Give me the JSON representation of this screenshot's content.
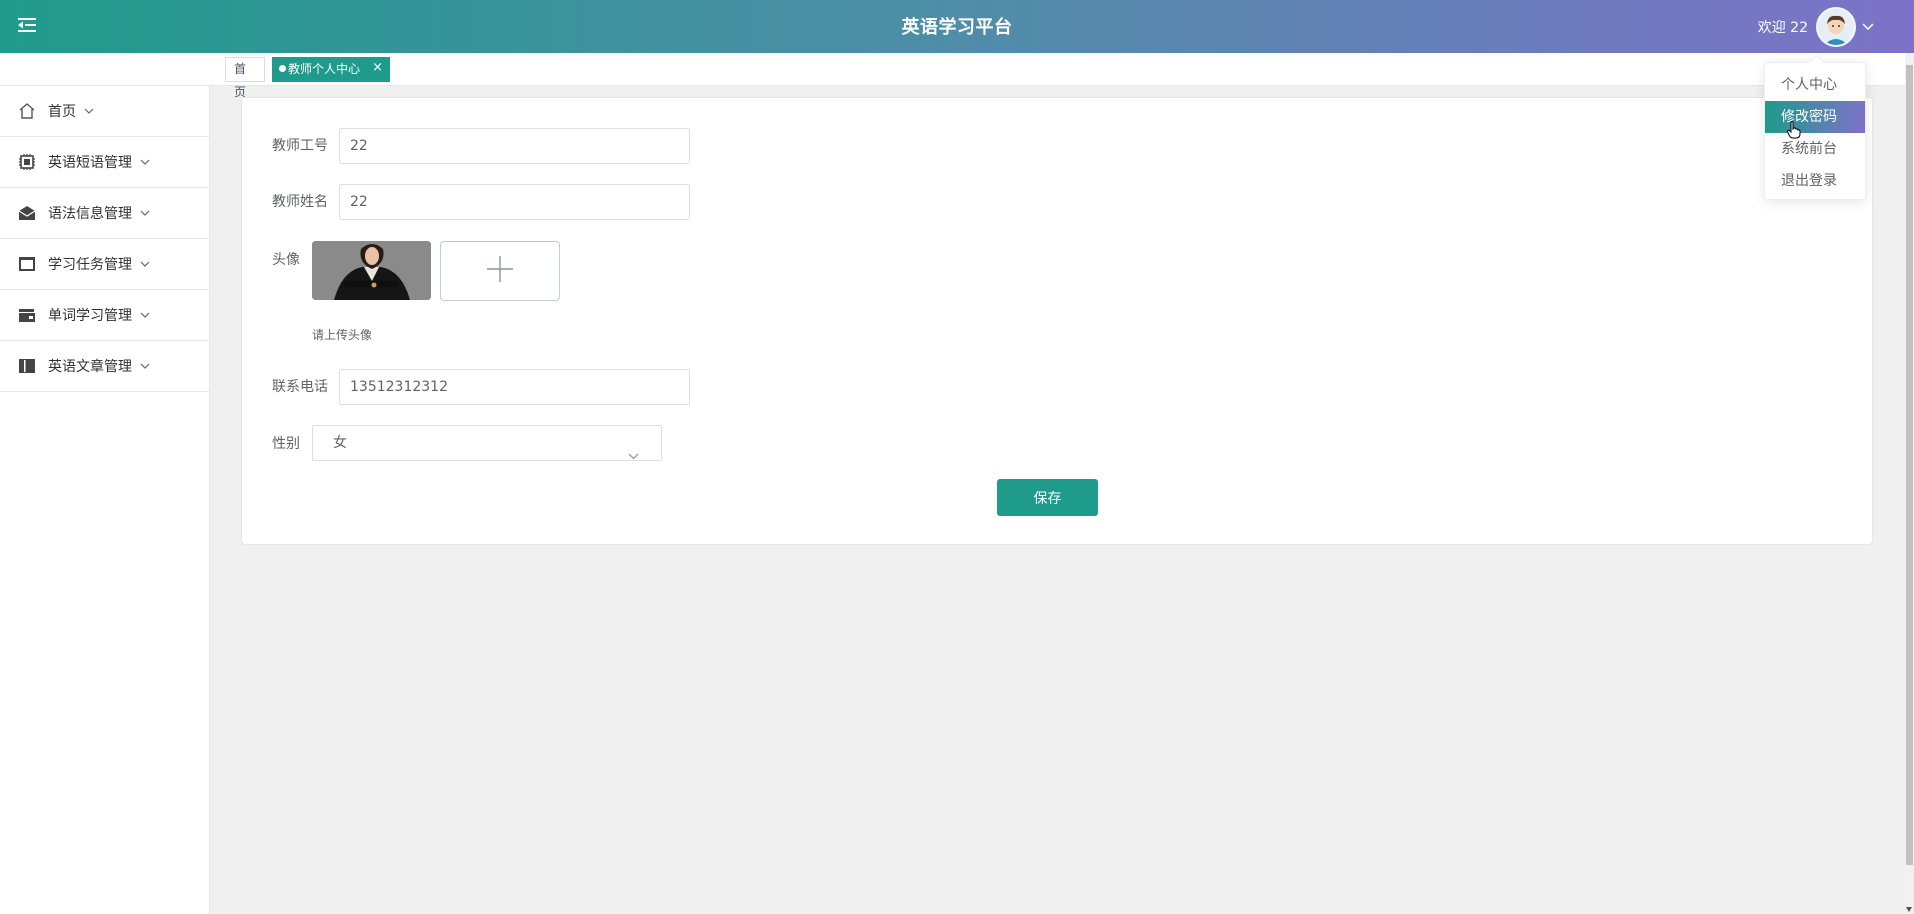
{
  "header": {
    "title": "英语学习平台",
    "welcome": "欢迎 22",
    "menu_icon": "menu-fold-icon",
    "caret_icon": "chevron-down-icon"
  },
  "user_menu": {
    "items": [
      {
        "label": "个人中心"
      },
      {
        "label": "修改密码",
        "active": true
      },
      {
        "label": "系统前台"
      },
      {
        "label": "退出登录"
      }
    ]
  },
  "tabs": {
    "home": "首页",
    "active": "教师个人中心",
    "close": "×"
  },
  "sidebar": {
    "items": [
      {
        "label": "首页",
        "icon": "home-icon"
      },
      {
        "label": "英语短语管理",
        "icon": "chip-icon"
      },
      {
        "label": "语法信息管理",
        "icon": "envelope-icon"
      },
      {
        "label": "学习任务管理",
        "icon": "panel-icon"
      },
      {
        "label": "单词学习管理",
        "icon": "wallet-icon"
      },
      {
        "label": "英语文章管理",
        "icon": "columns-icon"
      }
    ]
  },
  "form": {
    "teacher_id_label": "教师工号",
    "teacher_id_value": "22",
    "teacher_name_label": "教师姓名",
    "teacher_name_value": "22",
    "avatar_label": "头像",
    "upload_tip": "请上传头像",
    "phone_label": "联系电话",
    "phone_value": "13512312312",
    "gender_label": "性别",
    "gender_value": "女",
    "save_label": "保存"
  },
  "colors": {
    "primary": "#1f9b8b",
    "header_start": "#1f9b8b",
    "header_end": "#7d72c9"
  }
}
